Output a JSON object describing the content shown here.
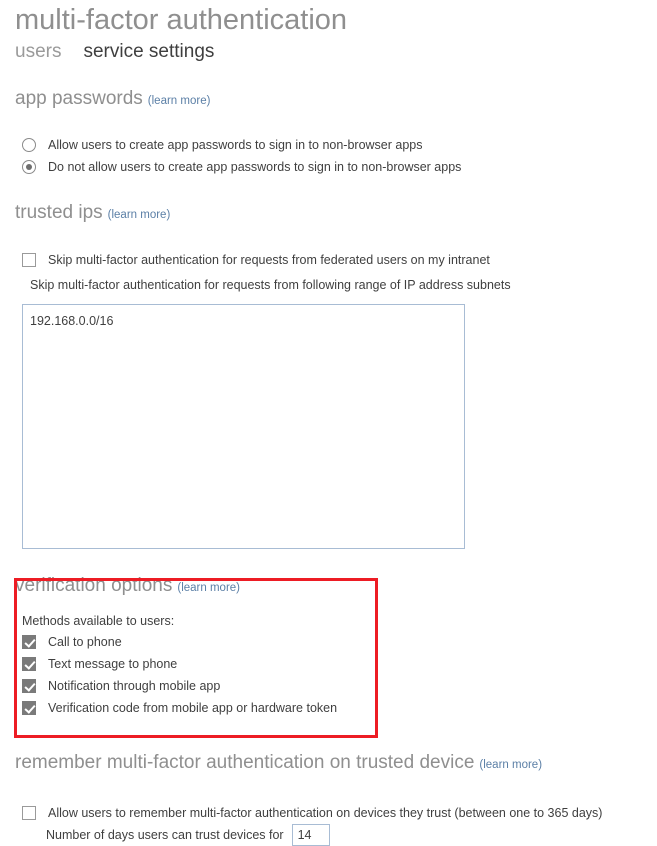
{
  "header": {
    "title": "multi-factor authentication",
    "tabs": [
      {
        "label": "users",
        "active": false
      },
      {
        "label": "service settings",
        "active": true
      }
    ]
  },
  "learn_more_label": "(learn more)",
  "sections": {
    "app_passwords": {
      "title": "app passwords",
      "options": [
        {
          "label": "Allow users to create app passwords to sign in to non-browser apps",
          "selected": false
        },
        {
          "label": "Do not allow users to create app passwords to sign in to non-browser apps",
          "selected": true
        }
      ]
    },
    "trusted_ips": {
      "title": "trusted ips",
      "federated_checkbox": {
        "label": "Skip multi-factor authentication for requests from federated users on my intranet",
        "checked": false
      },
      "subnet_note": "Skip multi-factor authentication for requests from following range of IP address subnets",
      "subnet_value": "192.168.0.0/16",
      "subnet_placeholder": ""
    },
    "verification_options": {
      "title": "verification options",
      "methods_label": "Methods available to users:",
      "methods": [
        {
          "label": "Call to phone",
          "checked": true
        },
        {
          "label": "Text message to phone",
          "checked": true
        },
        {
          "label": "Notification through mobile app",
          "checked": true
        },
        {
          "label": "Verification code from mobile app or hardware token",
          "checked": true
        }
      ],
      "highlight_color": "#ed1c24"
    },
    "remember_mfa": {
      "title": "remember multi-factor authentication on trusted device",
      "allow_checkbox": {
        "label": "Allow users to remember multi-factor authentication on devices they trust (between one to 365 days)",
        "checked": false
      },
      "days_label": "Number of days users can trust devices for",
      "days_value": "14"
    }
  }
}
